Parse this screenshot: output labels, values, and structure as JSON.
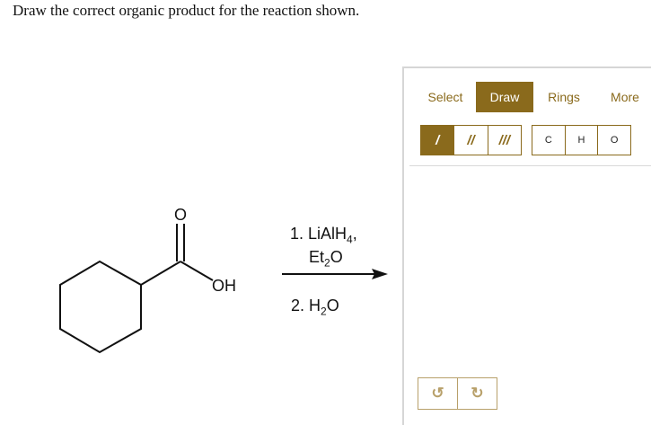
{
  "question": "Draw the correct organic product for the reaction shown.",
  "reactant": {
    "carbonyl_o": "O",
    "hydroxyl": "OH"
  },
  "reagents": {
    "step1_num": "1.",
    "step1_formula": "LiAlH",
    "step1_sub": "4",
    "step1_tail": ",",
    "solvent_pre": "Et",
    "solvent_sub": "2",
    "solvent_post": "O",
    "step2_num": "2.",
    "step2_pre": "H",
    "step2_sub": "2",
    "step2_post": "O"
  },
  "toolbar": {
    "tabs": [
      "Select",
      "Draw",
      "Rings",
      "More"
    ],
    "active_tab": "Draw",
    "bonds": [
      "/",
      "//",
      "///"
    ],
    "atoms": [
      "C",
      "H",
      "O"
    ]
  },
  "history": {
    "undo_icon": "undo-icon",
    "redo_icon": "redo-icon"
  },
  "colors": {
    "accent": "#8a6a1c",
    "disabled": "#b8a06a"
  }
}
